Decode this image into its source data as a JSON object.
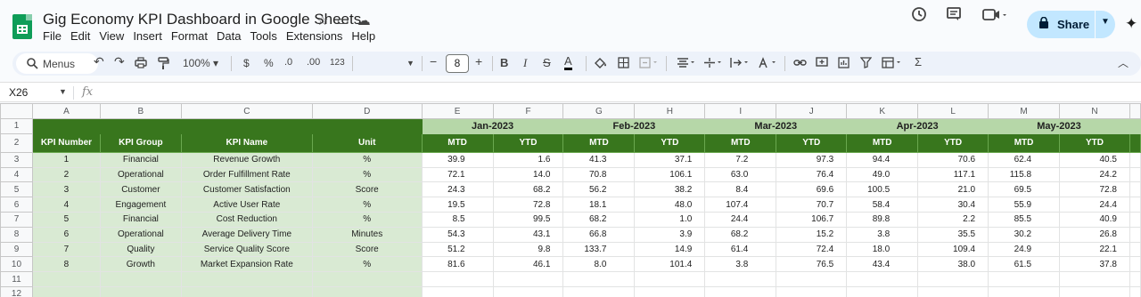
{
  "app": {
    "title": "Gig Economy KPI Dashboard in Google Sheets",
    "menu": [
      "File",
      "Edit",
      "View",
      "Insert",
      "Format",
      "Data",
      "Tools",
      "Extensions",
      "Help"
    ],
    "share_label": "Share",
    "accent": "#c2e7ff",
    "brand_green": "#0f9d58"
  },
  "toolbar": {
    "menus_label": "Menus",
    "zoom": "100%",
    "currency": "$",
    "percent": "%",
    "dec_decrease": ".0",
    "dec_increase": ".00",
    "format_123": "123",
    "font_size": "8",
    "icons": [
      "search-icon",
      "undo-icon",
      "redo-icon",
      "print-icon",
      "paint-format-icon",
      "bold-icon",
      "italic-icon",
      "strikethrough-icon",
      "text-color-icon",
      "fill-color-icon",
      "borders-icon",
      "merge-icon",
      "halign-icon",
      "valign-icon",
      "wrap-icon",
      "rotate-icon",
      "link-icon",
      "comment-icon",
      "chart-icon",
      "filter-icon",
      "filter-views-icon",
      "functions-icon",
      "collapse-icon"
    ]
  },
  "formula_bar": {
    "cell_ref": "X26",
    "fx": "fx"
  },
  "sheet": {
    "columns": [
      "A",
      "B",
      "C",
      "D",
      "E",
      "F",
      "G",
      "H",
      "I",
      "J",
      "K",
      "L",
      "M",
      "N"
    ],
    "row_numbers": [
      "1",
      "2",
      "3",
      "4",
      "5",
      "6",
      "7",
      "8",
      "9",
      "10",
      "11",
      "12"
    ],
    "months": [
      "Jan-2023",
      "Feb-2023",
      "Mar-2023",
      "Apr-2023",
      "May-2023"
    ],
    "headers": [
      "KPI Number",
      "KPI Group",
      "KPI Name",
      "Unit"
    ],
    "sub_headers": [
      "MTD",
      "YTD"
    ],
    "rows": [
      {
        "num": "1",
        "group": "Financial",
        "name": "Revenue Growth",
        "unit": "%",
        "vals": [
          "39.9",
          "1.6",
          "41.3",
          "37.1",
          "7.2",
          "97.3",
          "94.4",
          "70.6",
          "62.4",
          "40.5"
        ]
      },
      {
        "num": "2",
        "group": "Operational",
        "name": "Order Fulfillment Rate",
        "unit": "%",
        "vals": [
          "72.1",
          "14.0",
          "70.8",
          "106.1",
          "63.0",
          "76.4",
          "49.0",
          "117.1",
          "115.8",
          "24.2"
        ]
      },
      {
        "num": "3",
        "group": "Customer",
        "name": "Customer Satisfaction",
        "unit": "Score",
        "vals": [
          "24.3",
          "68.2",
          "56.2",
          "38.2",
          "8.4",
          "69.6",
          "100.5",
          "21.0",
          "69.5",
          "72.8"
        ]
      },
      {
        "num": "4",
        "group": "Engagement",
        "name": "Active User Rate",
        "unit": "%",
        "vals": [
          "19.5",
          "72.8",
          "18.1",
          "48.0",
          "107.4",
          "70.7",
          "58.4",
          "30.4",
          "55.9",
          "24.4"
        ]
      },
      {
        "num": "5",
        "group": "Financial",
        "name": "Cost Reduction",
        "unit": "%",
        "vals": [
          "8.5",
          "99.5",
          "68.2",
          "1.0",
          "24.4",
          "106.7",
          "89.8",
          "2.2",
          "85.5",
          "40.9"
        ]
      },
      {
        "num": "6",
        "group": "Operational",
        "name": "Average Delivery Time",
        "unit": "Minutes",
        "vals": [
          "54.3",
          "43.1",
          "66.8",
          "3.9",
          "68.2",
          "15.2",
          "3.8",
          "35.5",
          "30.2",
          "26.8"
        ]
      },
      {
        "num": "7",
        "group": "Quality",
        "name": "Service Quality Score",
        "unit": "Score",
        "vals": [
          "51.2",
          "9.8",
          "133.7",
          "14.9",
          "61.4",
          "72.4",
          "18.0",
          "109.4",
          "24.9",
          "22.1"
        ]
      },
      {
        "num": "8",
        "group": "Growth",
        "name": "Market Expansion Rate",
        "unit": "%",
        "vals": [
          "81.6",
          "46.1",
          "8.0",
          "101.4",
          "3.8",
          "76.5",
          "43.4",
          "38.0",
          "61.5",
          "37.8"
        ]
      }
    ],
    "header_dark": "#38761d",
    "header_light": "#b6d7a8",
    "cell_light": "#d9ead3"
  }
}
